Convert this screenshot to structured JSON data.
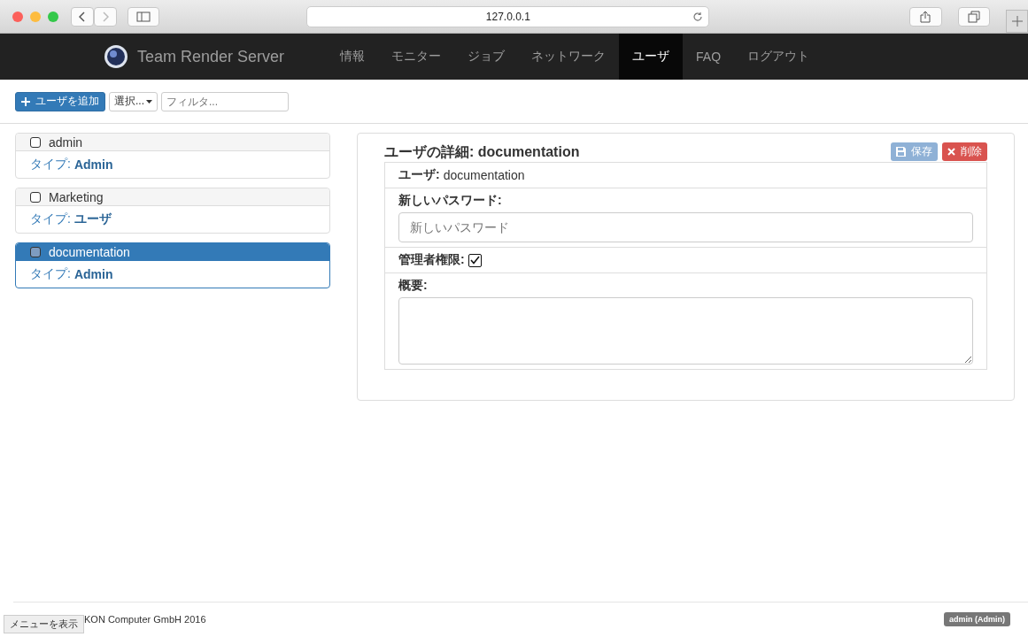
{
  "browser": {
    "address": "127.0.0.1"
  },
  "navbar": {
    "brand": "Team Render Server",
    "items": [
      {
        "label": "情報",
        "selected": false
      },
      {
        "label": "モニター",
        "selected": false
      },
      {
        "label": "ジョブ",
        "selected": false
      },
      {
        "label": "ネットワーク",
        "selected": false
      },
      {
        "label": "ユーザ",
        "selected": true
      },
      {
        "label": "FAQ",
        "selected": false
      },
      {
        "label": "ログアウト",
        "selected": false
      }
    ]
  },
  "toolbar": {
    "add_button": "ユーザを追加",
    "select_button": "選択...",
    "filter": {
      "placeholder": "フィルタ..."
    }
  },
  "users": [
    {
      "name": "admin",
      "type_label": "タイプ:",
      "type": "Admin",
      "checked": false,
      "selected": false
    },
    {
      "name": "Marketing",
      "type_label": "タイプ:",
      "type": "ユーザ",
      "checked": false,
      "selected": false
    },
    {
      "name": "documentation",
      "type_label": "タイプ:",
      "type": "Admin",
      "checked": false,
      "selected": true
    }
  ],
  "detail": {
    "title": "ユーザの詳細: documentation",
    "save_button": "保存",
    "delete_button": "削除",
    "user_label": "ユーザ:",
    "user_value": "documentation",
    "password_label": "新しいパスワード:",
    "password": {
      "placeholder": "新しいパスワード"
    },
    "admin_label": "管理者権限:",
    "admin_checked": true,
    "summary_label": "概要:"
  },
  "footer": {
    "menu_tooltip": "メニューを表示",
    "copyright": "KON Computer GmbH 2016",
    "user_badge": "admin (Admin)"
  }
}
